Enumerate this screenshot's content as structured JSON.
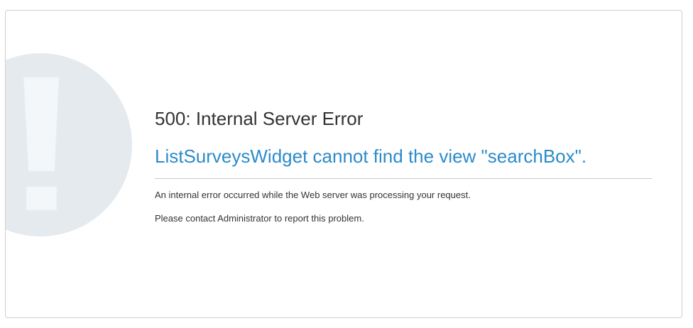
{
  "error": {
    "icon": "exclamation-icon",
    "title": "500: Internal Server Error",
    "message": "ListSurveysWidget cannot find the view \"searchBox\".",
    "details": [
      "An internal error occurred while the Web server was processing your request.",
      "Please contact Administrator to report this problem."
    ]
  },
  "colors": {
    "title": "#333333",
    "message": "#2b8bc9",
    "illustration_circle": "#e4eaee",
    "illustration_mark": "#f4f7f9",
    "border": "#cfcfcf"
  }
}
